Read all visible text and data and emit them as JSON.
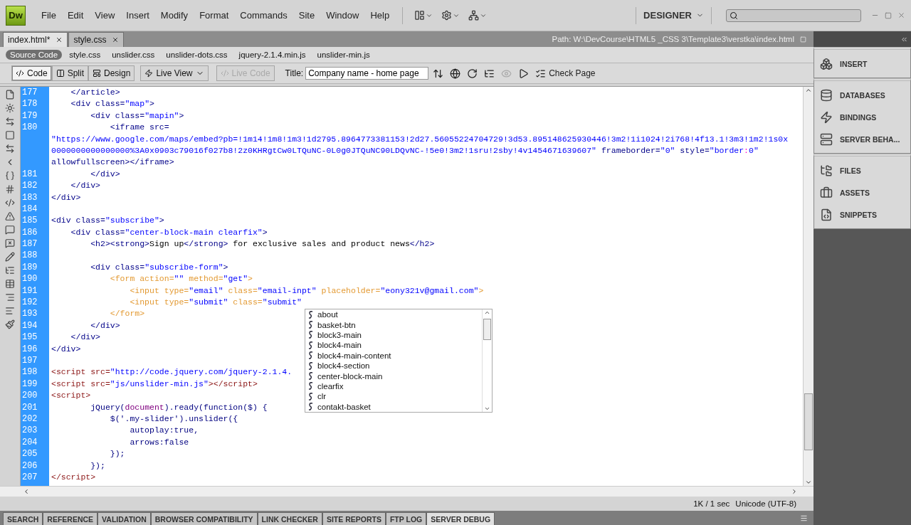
{
  "app": {
    "logo": "Dw",
    "menu": [
      "File",
      "Edit",
      "View",
      "Insert",
      "Modify",
      "Format",
      "Commands",
      "Site",
      "Window",
      "Help"
    ],
    "workspace": "DESIGNER"
  },
  "document_tabs": [
    {
      "label": "index.html*",
      "selected": true
    },
    {
      "label": "style.css",
      "selected": false
    }
  ],
  "path": "Path:  W:\\DevCourse\\HTML5 _CSS 3\\Template3\\verstka\\index.html",
  "related_files": [
    {
      "label": "Source Code",
      "selected": true
    },
    {
      "label": "style.css",
      "selected": false
    },
    {
      "label": "unslider.css",
      "selected": false
    },
    {
      "label": "unslider-dots.css",
      "selected": false
    },
    {
      "label": "jquery-2.1.4.min.js",
      "selected": false
    },
    {
      "label": "unslider-min.js",
      "selected": false
    }
  ],
  "toolbar": {
    "views": [
      {
        "label": "Code",
        "selected": true
      },
      {
        "label": "Split",
        "selected": false
      },
      {
        "label": "Design",
        "selected": false
      }
    ],
    "live_view": "Live View",
    "live_code": {
      "label": "Live Code",
      "disabled": true
    },
    "title_label": "Title:",
    "title_value": "Company name - home page",
    "check_page": "Check Page"
  },
  "code_lines": [
    {
      "number": "177",
      "segments": [
        {
          "kind": "tag",
          "text": "    </article>"
        }
      ]
    },
    {
      "number": "178",
      "segments": [
        {
          "kind": "tag",
          "text": "    <div class="
        },
        {
          "kind": "value",
          "text": "\"map\""
        },
        {
          "kind": "tag",
          "text": ">"
        }
      ]
    },
    {
      "number": "179",
      "segments": [
        {
          "kind": "tag",
          "text": "        <div class="
        },
        {
          "kind": "value",
          "text": "\"mapin\""
        },
        {
          "kind": "tag",
          "text": ">"
        }
      ]
    },
    {
      "number": "180",
      "segments": [
        {
          "kind": "tag",
          "text": "            <iframe src="
        }
      ]
    },
    {
      "segments": [
        {
          "kind": "value",
          "text": "\"https://www.google.com/maps/embed?pb=!1m14!1m8!1m3!1d2795.8964773381153!2d27.56055224704729!3d53.895148625930446!3m2!1i1024!2i768!4f13.1!3m3!1m2!1s0x"
        }
      ]
    },
    {
      "segments": [
        {
          "kind": "value",
          "text": "0000000000000000%3A0x0903c79016f027b8!2z0KHRgtCw0LTQuNC-0L0g0JTQuNC90LDQvNC-!5e0!3m2!1sru!2sby!4v1454671639607\""
        },
        {
          "kind": "tag",
          "text": " frameborder="
        },
        {
          "kind": "value",
          "text": "\"0\""
        },
        {
          "kind": "tag",
          "text": " style="
        },
        {
          "kind": "value",
          "text": "\"border"
        },
        {
          "kind": "punct",
          "text": ":"
        },
        {
          "kind": "value",
          "text": "0\""
        }
      ]
    },
    {
      "segments": [
        {
          "kind": "tag",
          "text": "allowfullscreen></iframe>"
        }
      ]
    },
    {
      "number": "181",
      "segments": [
        {
          "kind": "tag",
          "text": "        </div>"
        }
      ]
    },
    {
      "number": "182",
      "segments": [
        {
          "kind": "tag",
          "text": "    </div>"
        }
      ]
    },
    {
      "number": "183",
      "segments": [
        {
          "kind": "tag",
          "text": "</div>"
        }
      ]
    },
    {
      "number": "184"
    },
    {
      "number": "185",
      "segments": [
        {
          "kind": "tag",
          "text": "<div class="
        },
        {
          "kind": "value",
          "text": "\"subscribe\""
        },
        {
          "kind": "tag",
          "text": ">"
        }
      ]
    },
    {
      "number": "186",
      "segments": [
        {
          "kind": "tag",
          "text": "    <div class="
        },
        {
          "kind": "value",
          "text": "\"center-block-main clearfix\""
        },
        {
          "kind": "tag",
          "text": ">"
        }
      ]
    },
    {
      "number": "187",
      "segments": [
        {
          "kind": "tag",
          "text": "        <h2><strong>"
        },
        {
          "kind": "text",
          "text": "Sign up"
        },
        {
          "kind": "tag",
          "text": "</strong>"
        },
        {
          "kind": "text",
          "text": " for exclusive sales and product news"
        },
        {
          "kind": "tag",
          "text": "</h2>"
        }
      ]
    },
    {
      "number": "188"
    },
    {
      "number": "189",
      "segments": [
        {
          "kind": "tag",
          "text": "        <div class="
        },
        {
          "kind": "value",
          "text": "\"subscribe-form\""
        },
        {
          "kind": "tag",
          "text": ">"
        }
      ]
    },
    {
      "number": "190",
      "segments": [
        {
          "kind": "form",
          "text": "            <form action="
        },
        {
          "kind": "value",
          "text": "\"\""
        },
        {
          "kind": "form",
          "text": " method="
        },
        {
          "kind": "value",
          "text": "\"get\""
        },
        {
          "kind": "form",
          "text": ">"
        }
      ]
    },
    {
      "number": "191",
      "segments": [
        {
          "kind": "form",
          "text": "                <input type="
        },
        {
          "kind": "value",
          "text": "\"email\""
        },
        {
          "kind": "form",
          "text": " class="
        },
        {
          "kind": "value",
          "text": "\"email-inpt\""
        },
        {
          "kind": "form",
          "text": " placeholder="
        },
        {
          "kind": "value",
          "text": "\"eony321v@gmail.com\""
        },
        {
          "kind": "form",
          "text": ">"
        }
      ]
    },
    {
      "number": "192",
      "segments": [
        {
          "kind": "form",
          "text": "                <input type="
        },
        {
          "kind": "value",
          "text": "\"submit\""
        },
        {
          "kind": "form",
          "text": " class="
        },
        {
          "kind": "value",
          "text": "\"submit\""
        }
      ]
    },
    {
      "number": "193",
      "segments": [
        {
          "kind": "form",
          "text": "            </form>"
        }
      ]
    },
    {
      "number": "194",
      "segments": [
        {
          "kind": "tag",
          "text": "        </div>"
        }
      ]
    },
    {
      "number": "195",
      "segments": [
        {
          "kind": "tag",
          "text": "    </div>"
        }
      ]
    },
    {
      "number": "196",
      "segments": [
        {
          "kind": "tag",
          "text": "</div>"
        }
      ]
    },
    {
      "number": "197"
    },
    {
      "number": "198",
      "segments": [
        {
          "kind": "script",
          "text": "<script src="
        },
        {
          "kind": "value",
          "text": "\"http://code.jquery.com/jquery-2.1.4."
        }
      ]
    },
    {
      "number": "199",
      "segments": [
        {
          "kind": "script",
          "text": "<script src="
        },
        {
          "kind": "value",
          "text": "\"js/unslider-min.js\""
        },
        {
          "kind": "script",
          "text": "></script>"
        }
      ]
    },
    {
      "number": "200",
      "segments": [
        {
          "kind": "script",
          "text": "<script>"
        }
      ]
    },
    {
      "number": "201",
      "segments": [
        {
          "kind": "js",
          "text": "        jQuery("
        },
        {
          "kind": "keyword",
          "text": "document"
        },
        {
          "kind": "js",
          "text": ").ready(function($) {"
        }
      ]
    },
    {
      "number": "202",
      "segments": [
        {
          "kind": "js",
          "text": "            $('.my-slider').unslider({"
        }
      ]
    },
    {
      "number": "203",
      "segments": [
        {
          "kind": "js",
          "text": "                autoplay:true,"
        }
      ]
    },
    {
      "number": "204",
      "segments": [
        {
          "kind": "js",
          "text": "                arrows:false"
        }
      ]
    },
    {
      "number": "205",
      "segments": [
        {
          "kind": "js",
          "text": "            });"
        }
      ]
    },
    {
      "number": "206",
      "segments": [
        {
          "kind": "js",
          "text": "        });"
        }
      ]
    },
    {
      "number": "207",
      "segments": [
        {
          "kind": "script",
          "text": "</script>"
        }
      ]
    }
  ],
  "code_hints": [
    "about",
    "basket-btn",
    "block3-main",
    "block4-main",
    "block4-main-content",
    "block4-section",
    "center-block-main",
    "clearfix",
    "clr",
    "contakt-basket"
  ],
  "status": {
    "size": "1K / 1 sec",
    "encoding": "Unicode (UTF-8)"
  },
  "panel_tabs": [
    {
      "label": "SEARCH",
      "selected": false
    },
    {
      "label": "REFERENCE",
      "selected": false
    },
    {
      "label": "VALIDATION",
      "selected": false
    },
    {
      "label": "BROWSER COMPATIBILITY",
      "selected": false
    },
    {
      "label": "LINK CHECKER",
      "selected": false
    },
    {
      "label": "SITE REPORTS",
      "selected": false
    },
    {
      "label": "FTP LOG",
      "selected": false
    },
    {
      "label": "SERVER DEBUG",
      "selected": true
    }
  ],
  "side_panels": [
    [
      {
        "label": "INSERT",
        "kind": "insert"
      }
    ],
    [
      {
        "label": "DATABASES",
        "kind": "databases"
      },
      {
        "label": "BINDINGS",
        "kind": "bindings"
      },
      {
        "label": "SERVER BEHA...",
        "kind": "server"
      }
    ],
    [
      {
        "label": "FILES",
        "kind": "files"
      },
      {
        "label": "ASSETS",
        "kind": "assets"
      },
      {
        "label": "SNIPPETS",
        "kind": "snippets"
      }
    ]
  ]
}
